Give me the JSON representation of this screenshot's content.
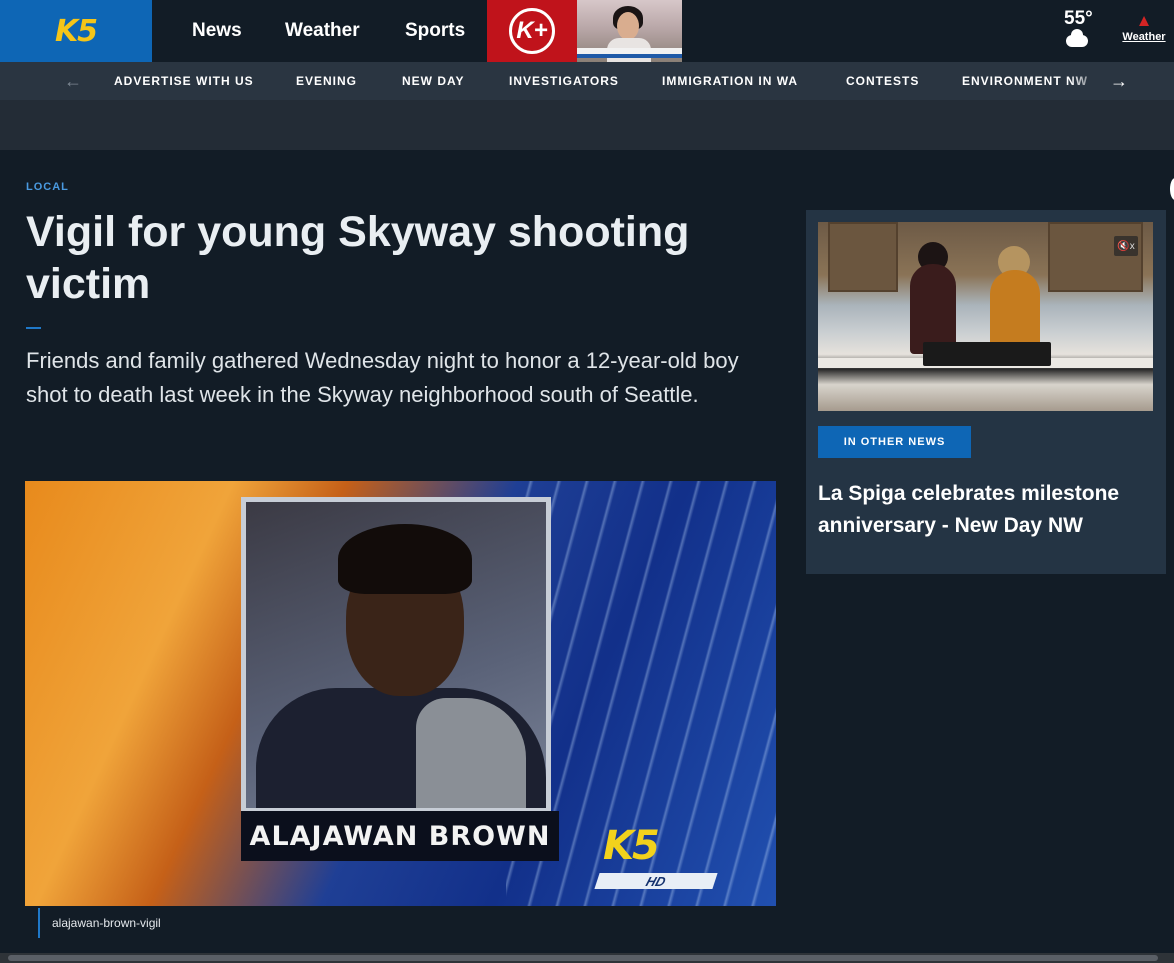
{
  "header": {
    "logo_text": "K5",
    "nav": [
      {
        "label": "News"
      },
      {
        "label": "Weather"
      },
      {
        "label": "Sports"
      }
    ],
    "kplus_label": "K+",
    "weather": {
      "temp": "55°",
      "icon": "cloud-icon"
    },
    "alert": {
      "label": "Weather",
      "icon": "warning-icon"
    }
  },
  "subnav": {
    "items": [
      "ADVERTISE WITH US",
      "EVENING",
      "NEW DAY",
      "INVESTIGATORS",
      "IMMIGRATION IN WA",
      "CONTESTS",
      "ENVIRONMENT NW"
    ],
    "prev_icon": "←",
    "next_icon": "→"
  },
  "article": {
    "category": "LOCAL",
    "headline": "Vigil for young Skyway shooting victim",
    "dek": "Friends and family gathered Wednesday night to honor a 12-year-old boy shot to death last week in the Skyway neighborhood south of Seattle.",
    "image": {
      "nameplate": "ALAJAWAN BROWN",
      "station_logo": "K5",
      "hd_label": "HD"
    },
    "caption": "alajawan-brown-vigil"
  },
  "sidebar": {
    "mute_icon": "🔇x",
    "badge": "IN OTHER NEWS",
    "title": "La Spiga celebrates milestone anniversary - New Day NW"
  },
  "colors": {
    "page_bg": "#121c26",
    "brand_blue": "#0e66b5",
    "kplus_red": "#c0131b",
    "category_blue": "#4a9ae0"
  }
}
